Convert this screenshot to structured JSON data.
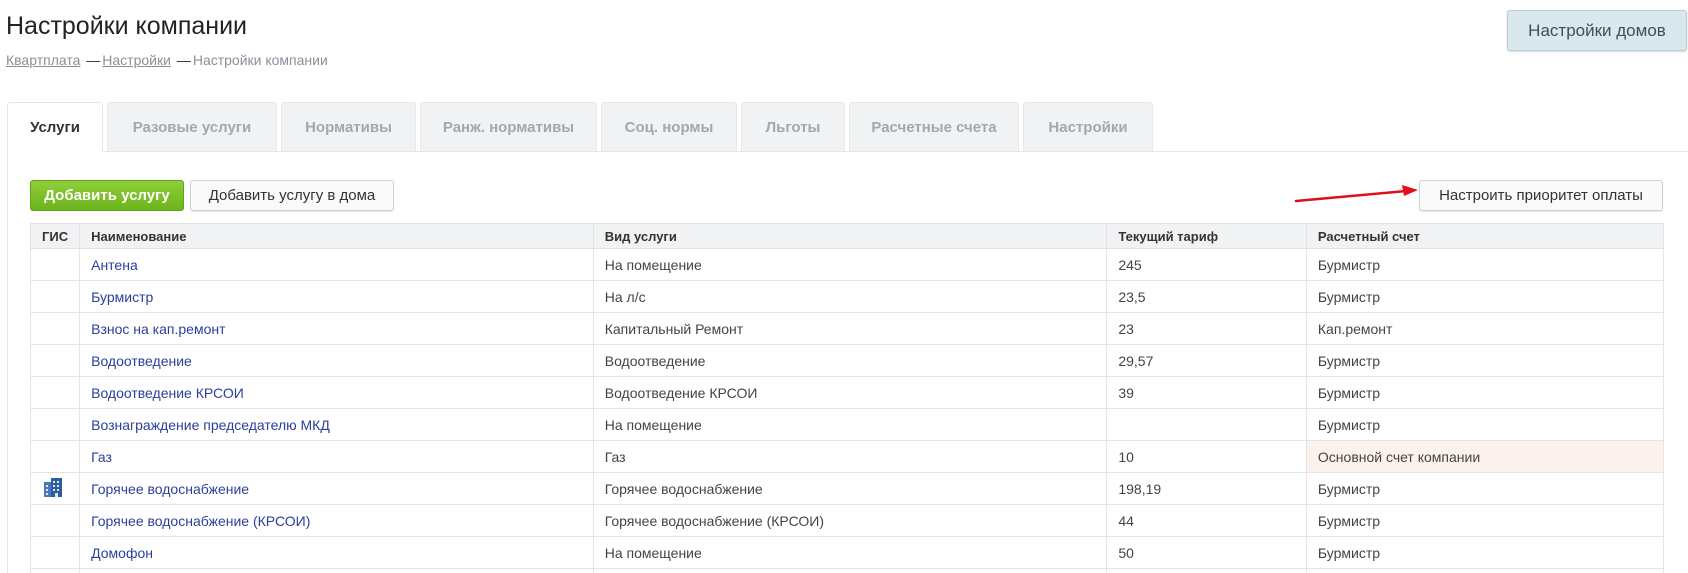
{
  "header": {
    "title": "Настройки компании",
    "houses_settings_label": "Настройки домов"
  },
  "breadcrumb": {
    "items": [
      "Квартплата",
      "Настройки",
      "Настройки компании"
    ],
    "separator": "—"
  },
  "tabs": [
    {
      "label": "Услуги",
      "active": true
    },
    {
      "label": "Разовые услуги",
      "active": false
    },
    {
      "label": "Нормативы",
      "active": false
    },
    {
      "label": "Ранж. нормативы",
      "active": false
    },
    {
      "label": "Соц. нормы",
      "active": false
    },
    {
      "label": "Льготы",
      "active": false
    },
    {
      "label": "Расчетные счета",
      "active": false
    },
    {
      "label": "Настройки",
      "active": false
    }
  ],
  "toolbar": {
    "add_service_label": "Добавить услугу",
    "add_service_homes_label": "Добавить услугу в дома",
    "payment_priority_label": "Настроить приоритет оплаты"
  },
  "table": {
    "columns": [
      "ГИС",
      "Наименование",
      "Вид услуги",
      "Текущий тариф",
      "Расчетный счет"
    ],
    "rows": [
      {
        "gis": false,
        "name": "Антена",
        "type": "На помещение",
        "tariff": "245",
        "account": "Бурмистр",
        "highlight": false
      },
      {
        "gis": false,
        "name": "Бурмистр",
        "type": "На л/с",
        "tariff": "23,5",
        "account": "Бурмистр",
        "highlight": false
      },
      {
        "gis": false,
        "name": "Взнос на кап.ремонт",
        "type": "Капитальный Ремонт",
        "tariff": "23",
        "account": "Кап.ремонт",
        "highlight": false
      },
      {
        "gis": false,
        "name": "Водоотведение",
        "type": "Водоотведение",
        "tariff": "29,57",
        "account": "Бурмистр",
        "highlight": false
      },
      {
        "gis": false,
        "name": "Водоотведение КРСОИ",
        "type": "Водоотведение КРСОИ",
        "tariff": "39",
        "account": "Бурмистр",
        "highlight": false
      },
      {
        "gis": false,
        "name": "Вознаграждение председателю МКД",
        "type": "На помещение",
        "tariff": "",
        "account": "Бурмистр",
        "highlight": false
      },
      {
        "gis": false,
        "name": "Газ",
        "type": "Газ",
        "tariff": "10",
        "account": "Основной счет компании",
        "highlight": true
      },
      {
        "gis": true,
        "name": "Горячее водоснабжение",
        "type": "Горячее водоснабжение",
        "tariff": "198,19",
        "account": "Бурмистр",
        "highlight": false
      },
      {
        "gis": false,
        "name": "Горячее водоснабжение (КРСОИ)",
        "type": "Горячее водоснабжение (КРСОИ)",
        "tariff": "44",
        "account": "Бурмистр",
        "highlight": false
      },
      {
        "gis": false,
        "name": "Домофон",
        "type": "На помещение",
        "tariff": "50",
        "account": "Бурмистр",
        "highlight": false
      },
      {
        "gis": false,
        "name": "",
        "type": "",
        "tariff": "",
        "account": "",
        "highlight": false
      }
    ]
  },
  "colors": {
    "accent_green": "#7bc02a",
    "link_blue": "#2c3e9a",
    "highlight_row": "#fdf1ee",
    "arrow_red": "#e0101a"
  },
  "icons": {
    "gis": "building-icon"
  }
}
